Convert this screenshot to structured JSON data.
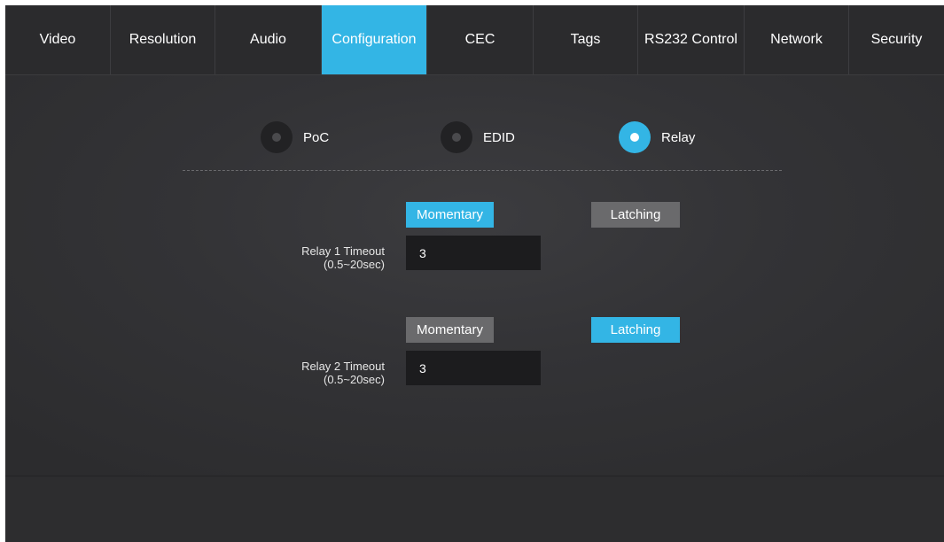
{
  "tabs": [
    {
      "label": "Video",
      "active": false
    },
    {
      "label": "Resolution",
      "active": false
    },
    {
      "label": "Audio",
      "active": false
    },
    {
      "label": "Configuration",
      "active": true
    },
    {
      "label": "CEC",
      "active": false
    },
    {
      "label": "Tags",
      "active": false
    },
    {
      "label": "RS232 Control",
      "active": false
    },
    {
      "label": "Network",
      "active": false
    },
    {
      "label": "Security",
      "active": false
    }
  ],
  "config_options": [
    {
      "label": "PoC",
      "selected": false
    },
    {
      "label": "EDID",
      "selected": false
    },
    {
      "label": "Relay",
      "selected": true
    }
  ],
  "relay1": {
    "momentary_label": "Momentary",
    "latching_label": "Latching",
    "mode": "Momentary",
    "timeout_label_line1": "Relay 1 Timeout",
    "timeout_label_line2": "(0.5~20sec)",
    "timeout_value": "3"
  },
  "relay2": {
    "momentary_label": "Momentary",
    "latching_label": "Latching",
    "mode": "Latching",
    "timeout_label_line1": "Relay 2 Timeout",
    "timeout_label_line2": "(0.5~20sec)",
    "timeout_value": "3"
  },
  "colors": {
    "accent": "#33b5e5",
    "inactive_button": "#6a6a6c",
    "panel_bg": "#2e2e30",
    "input_bg": "#1c1c1e"
  }
}
